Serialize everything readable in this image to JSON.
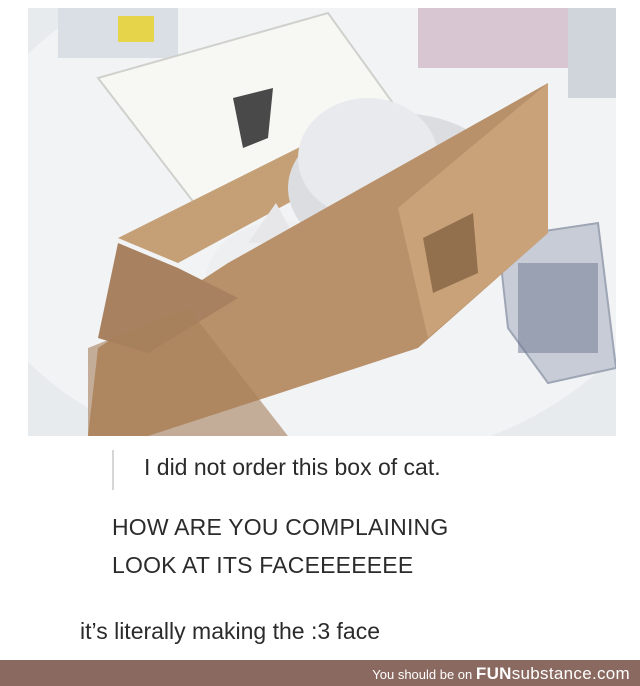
{
  "post": {
    "line1": "I did not order this box of cat.",
    "line2": "HOW ARE YOU COMPLAINING",
    "line3": "LOOK AT ITS FACEEEEEEE",
    "line4": "it’s literally making the :3 face"
  },
  "footer": {
    "prefix": "You should be on",
    "brand_strong": "FUN",
    "brand_light": "substance",
    "brand_suffix": ".com"
  },
  "colors": {
    "footer_bg": "#8a6a60",
    "text": "#2b2b2b",
    "box": "#b8916a"
  }
}
